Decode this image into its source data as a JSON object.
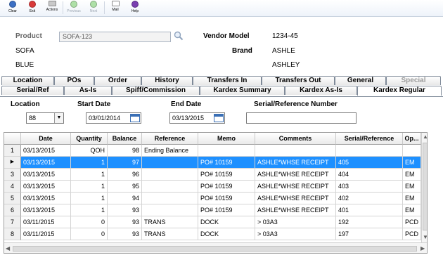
{
  "toolbar": {
    "buttons": [
      {
        "label": "Clear",
        "color": "#3b6fc4",
        "enabled": true
      },
      {
        "label": "Exit",
        "color": "#d93a3a",
        "enabled": true
      },
      {
        "label": "Actions",
        "color": "#c9c9c9",
        "enabled": true
      },
      {
        "label": "Previous",
        "color": "#aee0a7",
        "enabled": false
      },
      {
        "label": "Next",
        "color": "#aee0a7",
        "enabled": false
      },
      {
        "label": "Mail",
        "color": "#ffffff",
        "enabled": true
      },
      {
        "label": "Help",
        "color": "#7a3fb0",
        "enabled": true
      }
    ]
  },
  "header": {
    "product_label": "Product",
    "product_value": "SOFA-123",
    "desc1": "SOFA",
    "desc2": "BLUE",
    "vendor_model_label": "Vendor Model",
    "vendor_model_value": "1234-45",
    "brand_label": "Brand",
    "brand_value": "ASHLE",
    "brand_desc": "ASHLEY"
  },
  "tabs_row1": [
    "Location",
    "POs",
    "Order",
    "History",
    "Transfers In",
    "Transfers Out",
    "General",
    "Special"
  ],
  "tabs_row2": [
    "Serial/Ref",
    "As-Is",
    "Spiff/Commission",
    "Kardex Summary",
    "Kardex As-Is",
    "Kardex Regular"
  ],
  "active_tab": "Kardex Regular",
  "filters": {
    "location_label": "Location",
    "location_value": "88",
    "start_date_label": "Start Date",
    "start_date_value": "03/01/2014",
    "end_date_label": "End Date",
    "end_date_value": "03/13/2015",
    "serial_label": "Serial/Reference Number",
    "serial_value": ""
  },
  "grid": {
    "columns": [
      "Date",
      "Quantity",
      "Balance",
      "Reference",
      "Memo",
      "Comments",
      "Serial/Reference",
      "Op..."
    ],
    "selected_row": 2,
    "rows": [
      {
        "num": "1",
        "date": "03/13/2015",
        "qty": "QOH",
        "bal": "98",
        "ref": "Ending Balance",
        "memo": "",
        "comments": "",
        "serial": "",
        "op": ""
      },
      {
        "num": "",
        "date": "03/13/2015",
        "qty": "1",
        "bal": "97",
        "ref": "",
        "memo": "PO# 10159",
        "comments": "ASHLE*WHSE RECEIPT",
        "serial": "405",
        "op": "EM"
      },
      {
        "num": "3",
        "date": "03/13/2015",
        "qty": "1",
        "bal": "96",
        "ref": "",
        "memo": "PO# 10159",
        "comments": "ASHLE*WHSE RECEIPT",
        "serial": "404",
        "op": "EM"
      },
      {
        "num": "4",
        "date": "03/13/2015",
        "qty": "1",
        "bal": "95",
        "ref": "",
        "memo": "PO# 10159",
        "comments": "ASHLE*WHSE RECEIPT",
        "serial": "403",
        "op": "EM"
      },
      {
        "num": "5",
        "date": "03/13/2015",
        "qty": "1",
        "bal": "94",
        "ref": "",
        "memo": "PO# 10159",
        "comments": "ASHLE*WHSE RECEIPT",
        "serial": "402",
        "op": "EM"
      },
      {
        "num": "6",
        "date": "03/13/2015",
        "qty": "1",
        "bal": "93",
        "ref": "",
        "memo": "PO# 10159",
        "comments": "ASHLE*WHSE RECEIPT",
        "serial": "401",
        "op": "EM"
      },
      {
        "num": "7",
        "date": "03/11/2015",
        "qty": "0",
        "bal": "93",
        "ref": "TRANS",
        "memo": "DOCK",
        "comments": "> 03A3",
        "serial": "192",
        "op": "PCD"
      },
      {
        "num": "8",
        "date": "03/11/2015",
        "qty": "0",
        "bal": "93",
        "ref": "TRANS",
        "memo": "DOCK",
        "comments": "> 03A3",
        "serial": "197",
        "op": "PCD"
      }
    ]
  },
  "colors": {
    "selection": "#1e90ff",
    "tab_border": "#7f8a99"
  }
}
